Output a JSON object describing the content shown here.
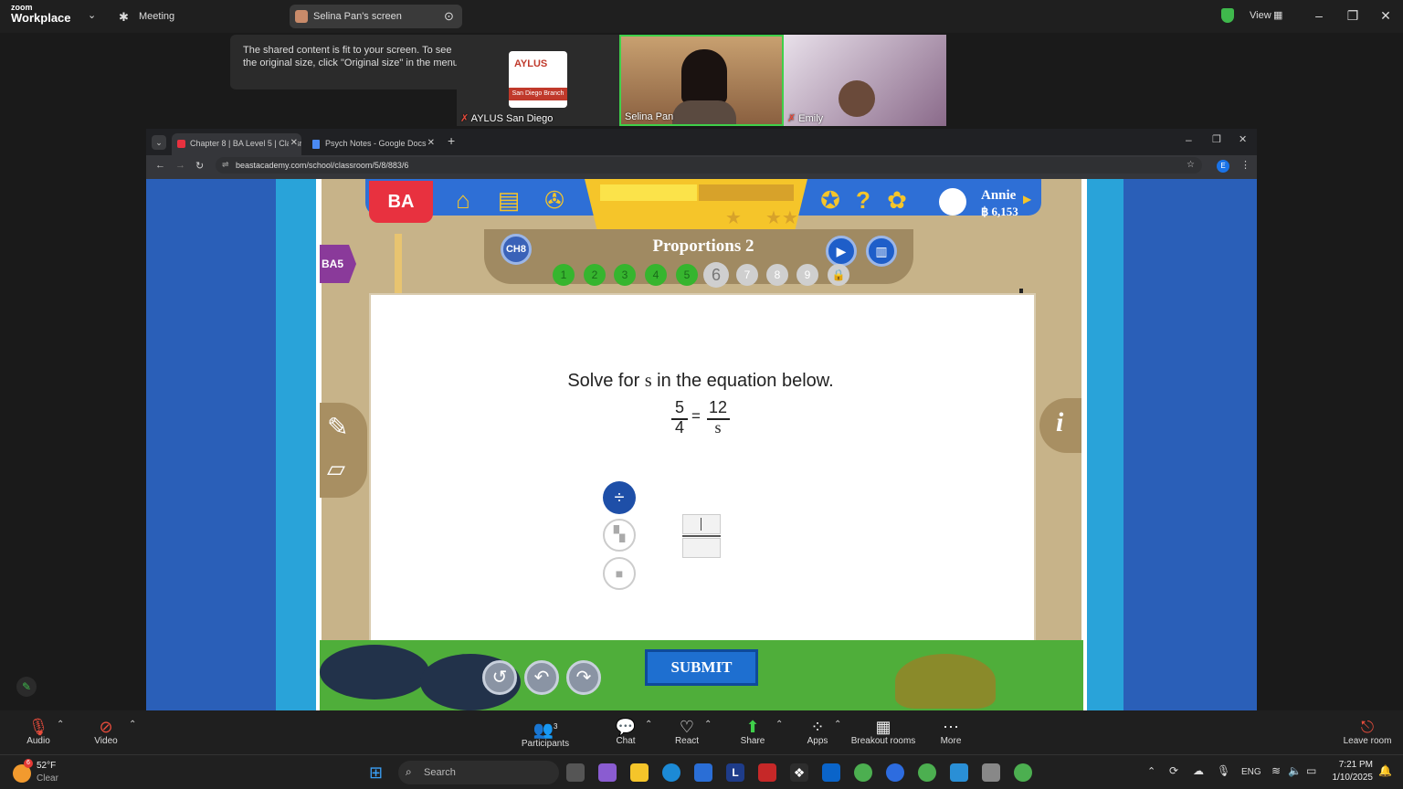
{
  "zoom": {
    "logo_small": "zoom",
    "logo_big": "Workplace",
    "meeting_label": "Meeting",
    "screen_label": "Selina Pan's screen",
    "view_label": "View",
    "tooltip": "The shared content is fit to your screen. To see the original size, click \"Original size\" in the menu.",
    "participants": [
      {
        "name": "AYLUS San Diego",
        "card_title": "AYLUS",
        "card_sub": "San Diego Branch"
      },
      {
        "name": "Selina Pan"
      },
      {
        "name": "Emily"
      }
    ]
  },
  "browser": {
    "tabs": [
      {
        "label": "Chapter 8 | BA Level 5 | Classro"
      },
      {
        "label": "Psych Notes - Google Docs"
      }
    ],
    "url": "beastacademy.com/school/classroom/5/8/883/6",
    "profile_letter": "E"
  },
  "game": {
    "logo": "BA",
    "user_name": "Annie",
    "currency": "฿ 6,153",
    "chapter_badge": "CH8",
    "side_badge": "BA5",
    "lesson_title": "Proportions 2",
    "progress_dots": [
      "1",
      "2",
      "3",
      "4",
      "5",
      "6",
      "7",
      "8",
      "9"
    ],
    "prompt_pre": "Solve for",
    "prompt_var": "s",
    "prompt_post": "in the equation below.",
    "eq_left_num": "5",
    "eq_left_den": "4",
    "eq_equals": "=",
    "eq_right_num": "12",
    "eq_right_den": "s",
    "submit_label": "SUBMIT",
    "info_label": "i"
  },
  "toolbar": {
    "audio": "Audio",
    "video": "Video",
    "participants": "Participants",
    "participants_count": "3",
    "chat": "Chat",
    "react": "React",
    "share": "Share",
    "apps": "Apps",
    "breakout": "Breakout rooms",
    "more": "More",
    "leave": "Leave room"
  },
  "taskbar": {
    "weather_temp": "52°F",
    "weather_desc": "Clear",
    "weather_badge": "6",
    "search_placeholder": "Search",
    "lang": "ENG",
    "time": "7:21 PM",
    "date": "1/10/2025"
  },
  "colors": {
    "zoom_bg": "#1f1f1f",
    "game_blue": "#2a5fb8",
    "submit_blue": "#1e6fd0",
    "done_green": "#36b52e",
    "brand_red": "#e8313f"
  }
}
